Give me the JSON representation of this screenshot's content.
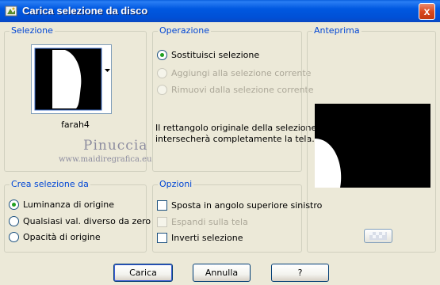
{
  "window": {
    "title": "Carica selezione da disco",
    "close_label": "x"
  },
  "selezione": {
    "group_label": "Selezione",
    "file_name": "farah4"
  },
  "operazione": {
    "group_label": "Operazione",
    "options": [
      {
        "label": "Sostituisci selezione",
        "checked": true,
        "enabled": true
      },
      {
        "label": "Aggiungi alla selezione corrente",
        "checked": false,
        "enabled": false
      },
      {
        "label": "Rimuovi dalla selezione corrente",
        "checked": false,
        "enabled": false
      }
    ],
    "description_line1": "Il rettangolo originale della selezione",
    "description_line2": "intersecherà completamente la tela."
  },
  "anteprima": {
    "group_label": "Anteprima"
  },
  "crea": {
    "group_label": "Crea selezione da",
    "options": [
      {
        "label": "Luminanza di origine",
        "checked": true
      },
      {
        "label": "Qualsiasi val. diverso da zero",
        "checked": false
      },
      {
        "label": "Opacità di origine",
        "checked": false
      }
    ]
  },
  "opzioni": {
    "group_label": "Opzioni",
    "options": [
      {
        "label": "Sposta in angolo superiore sinistro",
        "checked": false,
        "enabled": true
      },
      {
        "label": "Espandi sulla tela",
        "checked": false,
        "enabled": false
      },
      {
        "label": "Inverti selezione",
        "checked": false,
        "enabled": true
      }
    ]
  },
  "buttons": {
    "carica": "Carica",
    "annulla": "Annulla",
    "help": "?"
  },
  "watermark": {
    "line1": "Pinuccia",
    "line2": "www.maidiregrafica.eu"
  },
  "colors": {
    "titlebar": "#0058e0",
    "group_label": "#0046d5",
    "dialog_bg": "#ece9d8"
  },
  "icons": {
    "title": "app-icon",
    "dropdown": "dropdown-arrow-icon",
    "preview_button": "preview-toggle-icon"
  }
}
